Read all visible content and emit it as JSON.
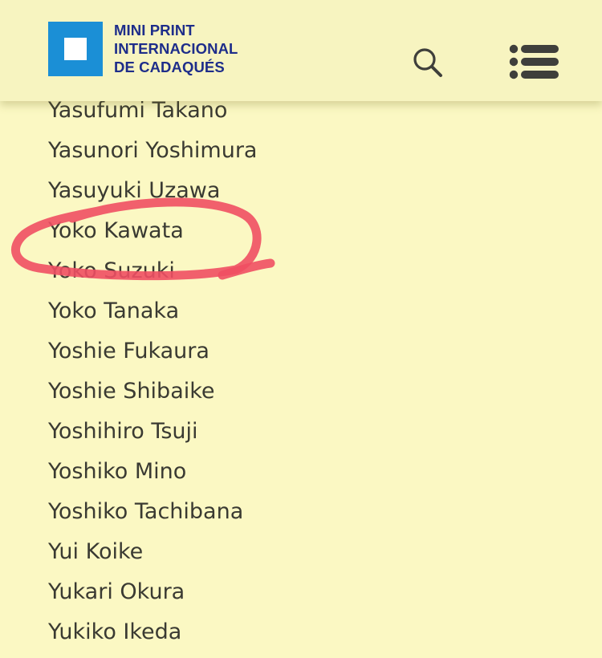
{
  "header": {
    "logo": {
      "line1": "MINI PRINT",
      "line2": "INTERNACIONAL",
      "line3": "DE CADAQUÉS"
    },
    "search_icon": "search-icon",
    "menu_icon": "menu-icon"
  },
  "artists": [
    "Yasufumi Takano",
    "Yasunori Yoshimura",
    "Yasuyuki Uzawa",
    "Yoko Kawata",
    "Yoko Suzuki",
    "Yoko Tanaka",
    "Yoshie Fukaura",
    "Yoshie Shibaike",
    "Yoshihiro Tsuji",
    "Yoshiko Mino",
    "Yoshiko Tachibana",
    "Yui Koike",
    "Yukari Okura",
    "Yukiko Ikeda"
  ],
  "annotation": {
    "circled_item": "Yoko Kawata",
    "color": "#ef4f63"
  },
  "colors": {
    "background": "#fbf8c3",
    "header_background": "#f7f4c0",
    "logo_blue": "#1b8fd6",
    "logo_text": "#1e2d8a",
    "text": "#3a3a32",
    "icon": "#3f3f3b"
  }
}
